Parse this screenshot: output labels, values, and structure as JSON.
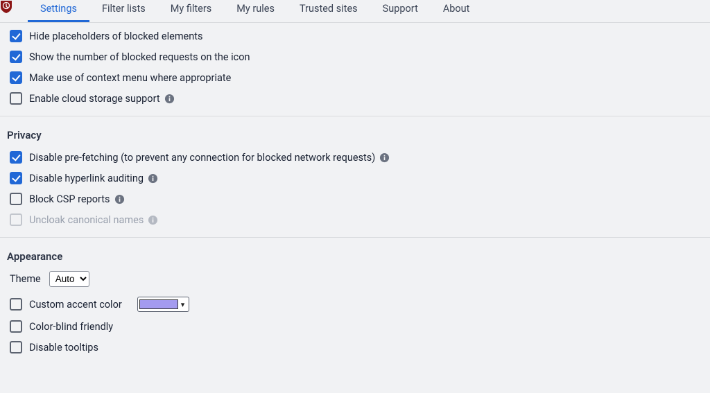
{
  "tabs": {
    "settings": "Settings",
    "filter_lists": "Filter lists",
    "my_filters": "My filters",
    "my_rules": "My rules",
    "trusted_sites": "Trusted sites",
    "support": "Support",
    "about": "About"
  },
  "general": {
    "hide_placeholders": "Hide placeholders of blocked elements",
    "show_blocked_count": "Show the number of blocked requests on the icon",
    "context_menu": "Make use of context menu where appropriate",
    "cloud_storage": "Enable cloud storage support"
  },
  "privacy": {
    "title": "Privacy",
    "disable_prefetch": "Disable pre-fetching (to prevent any connection for blocked network requests)",
    "disable_hyperlink_auditing": "Disable hyperlink auditing",
    "block_csp": "Block CSP reports",
    "uncloak_canonical": "Uncloak canonical names"
  },
  "appearance": {
    "title": "Appearance",
    "theme_label": "Theme",
    "theme_value": "Auto",
    "custom_accent": "Custom accent color",
    "accent_color": "#a49bf0",
    "color_blind": "Color-blind friendly",
    "disable_tooltips": "Disable tooltips"
  }
}
